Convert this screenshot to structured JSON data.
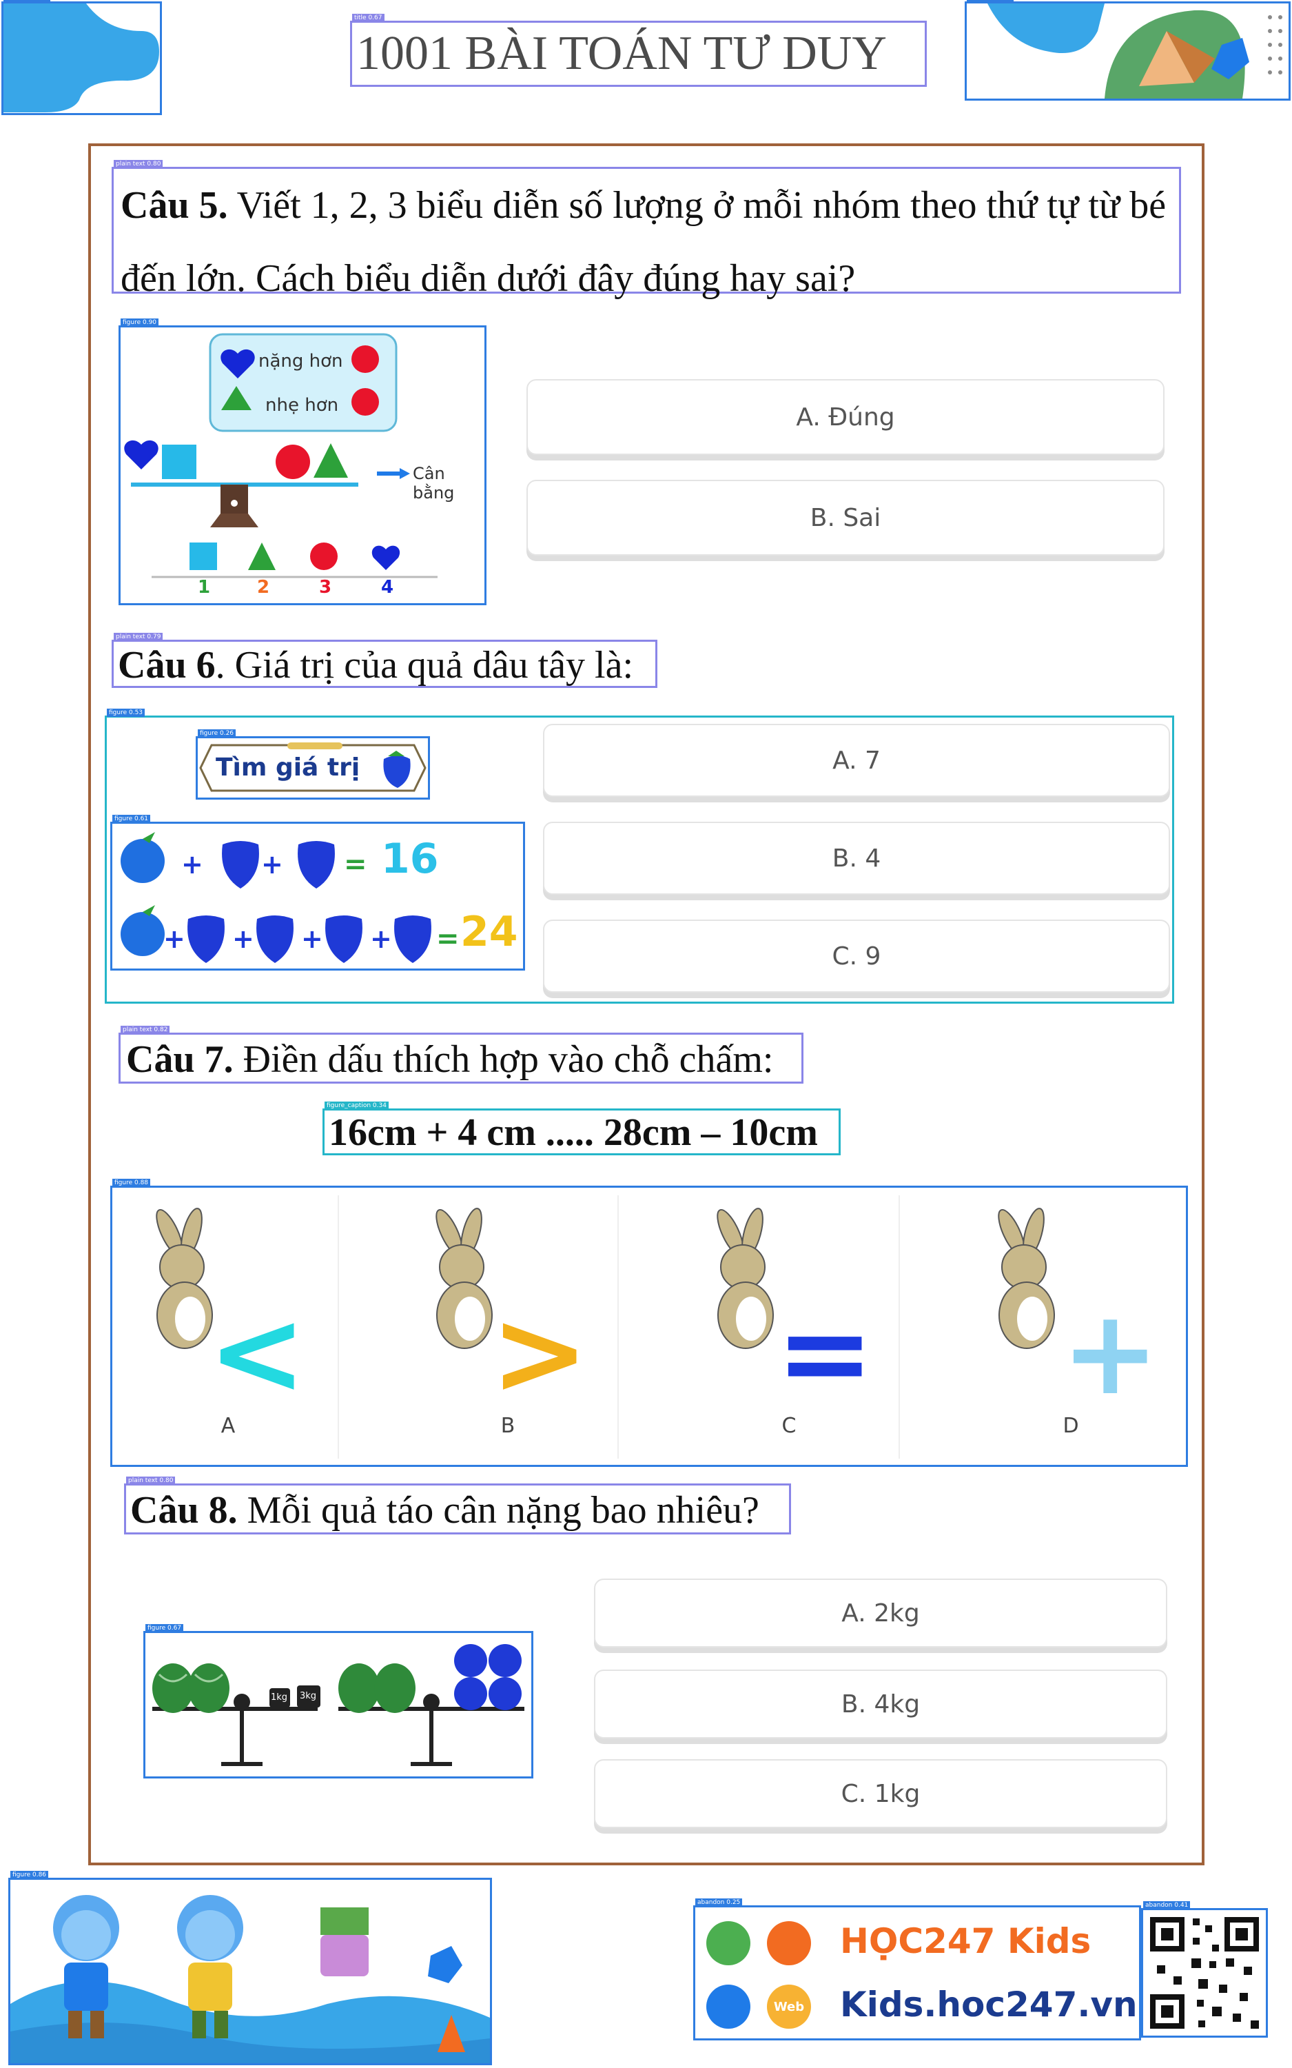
{
  "header": {
    "title": "1001 BÀI TOÁN TƯ DUY"
  },
  "q5": {
    "number": "Câu 5.",
    "text": "Viết 1, 2, 3 biểu diễn số lượng ở mỗi nhóm theo thứ tự từ bé đến lớn. Cách biểu diễn dưới đây đúng hay sai?",
    "figure": {
      "heavier": "nặng hơn",
      "lighter": "nhẹ hơn",
      "balanced": "Cân bằng",
      "numbers": [
        "1",
        "2",
        "3",
        "4"
      ]
    },
    "answers": [
      "A. Đúng",
      "B. Sai"
    ]
  },
  "q6": {
    "number": "Câu 6",
    "text": ". Giá trị của quả dâu tây là:",
    "figure": {
      "banner": "Tìm giá trị",
      "result1": "16",
      "result2": "24"
    },
    "answers": [
      "A. 7",
      "B. 4",
      "C. 9"
    ]
  },
  "q7": {
    "number": "Câu 7.",
    "text": "Điền dấu thích hợp vào chỗ chấm:",
    "equation": "16cm + 4 cm ..... 28cm – 10cm",
    "options": [
      {
        "label": "A",
        "symbol": "<",
        "color": "#23d9e0"
      },
      {
        "label": "B",
        "symbol": ">",
        "color": "#f3b01a"
      },
      {
        "label": "C",
        "symbol": "=",
        "color": "#1c3be0"
      },
      {
        "label": "D",
        "symbol": "+",
        "color": "#8fd3f2"
      }
    ]
  },
  "q8": {
    "number": "Câu 8.",
    "text": "Mỗi quả táo cân nặng bao nhiêu?",
    "figure": {
      "weight1": "1kg",
      "weight2": "3kg"
    },
    "answers": [
      "A. 2kg",
      "B. 4kg",
      "C. 1kg"
    ]
  },
  "footer": {
    "brand": "HỌC247 Kids",
    "url": "Kids.hoc247.vn",
    "web_badge": "Web"
  },
  "colors": {
    "frame": "#a0623a",
    "detect_blue": "#2f7de1",
    "detect_text": "#8a86e8",
    "detect_cyan": "#25b6c9",
    "brand_orange": "#f26b21"
  }
}
